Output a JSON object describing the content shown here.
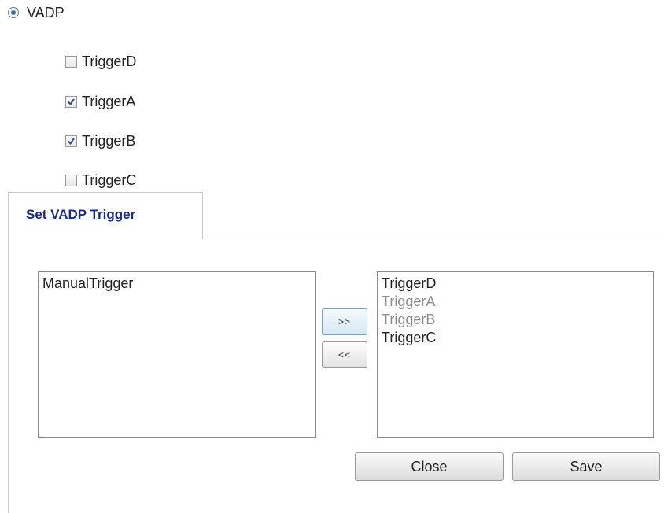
{
  "mode": {
    "label": "VADP",
    "selected": true
  },
  "triggers": [
    {
      "label": "TriggerD",
      "checked": false
    },
    {
      "label": "TriggerA",
      "checked": true
    },
    {
      "label": "TriggerB",
      "checked": true
    },
    {
      "label": "TriggerC",
      "checked": false
    }
  ],
  "tab": {
    "label": "Set VADP Trigger"
  },
  "available_list": {
    "items": [
      "ManualTrigger"
    ]
  },
  "selected_list": {
    "items": [
      {
        "label": "TriggerD",
        "dimmed": false
      },
      {
        "label": "TriggerA",
        "dimmed": true
      },
      {
        "label": "TriggerB",
        "dimmed": true
      },
      {
        "label": "TriggerC",
        "dimmed": false
      }
    ]
  },
  "move": {
    "add_label": ">>",
    "remove_label": "<<"
  },
  "actions": {
    "close_label": "Close",
    "save_label": "Save"
  },
  "colors": {
    "tab_label": "#1a2a8c",
    "dimmed_item": "#8d8d8d",
    "radio_dot": "#3b6ea8"
  }
}
